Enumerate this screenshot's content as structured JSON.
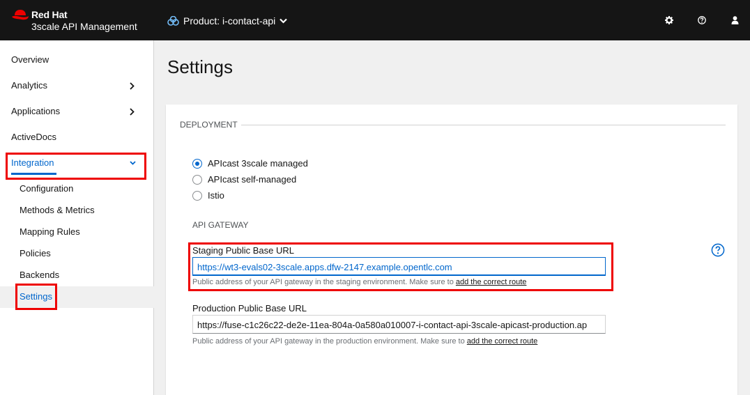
{
  "brand": {
    "line1": "Red Hat",
    "line2": "3scale API Management"
  },
  "header": {
    "product_label": "Product: i-contact-api"
  },
  "icons": {
    "settings": "gear-icon",
    "help": "question-circle-icon",
    "user": "user-icon",
    "product": "cubes-icon"
  },
  "colors": {
    "accent": "#0066cc",
    "header_bg": "#151515",
    "highlight": "#ee0000"
  },
  "sidebar": {
    "items": [
      {
        "label": "Overview"
      },
      {
        "label": "Analytics"
      },
      {
        "label": "Applications"
      },
      {
        "label": "ActiveDocs"
      },
      {
        "label": "Integration"
      }
    ],
    "sub_items": [
      {
        "label": "Configuration"
      },
      {
        "label": "Methods & Metrics"
      },
      {
        "label": "Mapping Rules"
      },
      {
        "label": "Policies"
      },
      {
        "label": "Backends"
      },
      {
        "label": "Settings"
      }
    ]
  },
  "main": {
    "title": "Settings",
    "deployment": {
      "legend": "DEPLOYMENT",
      "options": [
        {
          "label": "APIcast 3scale managed",
          "checked": true
        },
        {
          "label": "APIcast self-managed",
          "checked": false
        },
        {
          "label": "Istio",
          "checked": false
        }
      ]
    },
    "gateway": {
      "heading": "API GATEWAY",
      "staging_label": "Staging Public Base URL",
      "staging_value": "https://wt3-evals02-3scale.apps.dfw-2147.example.opentlc.com",
      "staging_help": "Public address of your API gateway in the staging environment. Make sure to ",
      "staging_link": "add the correct route",
      "production_label": "Production Public Base URL",
      "production_value": "https://fuse-c1c26c22-de2e-11ea-804a-0a580a010007-i-contact-api-3scale-apicast-production.ap",
      "production_help": "Public address of your API gateway in the production environment. Make sure to ",
      "production_link": "add the correct route"
    }
  }
}
